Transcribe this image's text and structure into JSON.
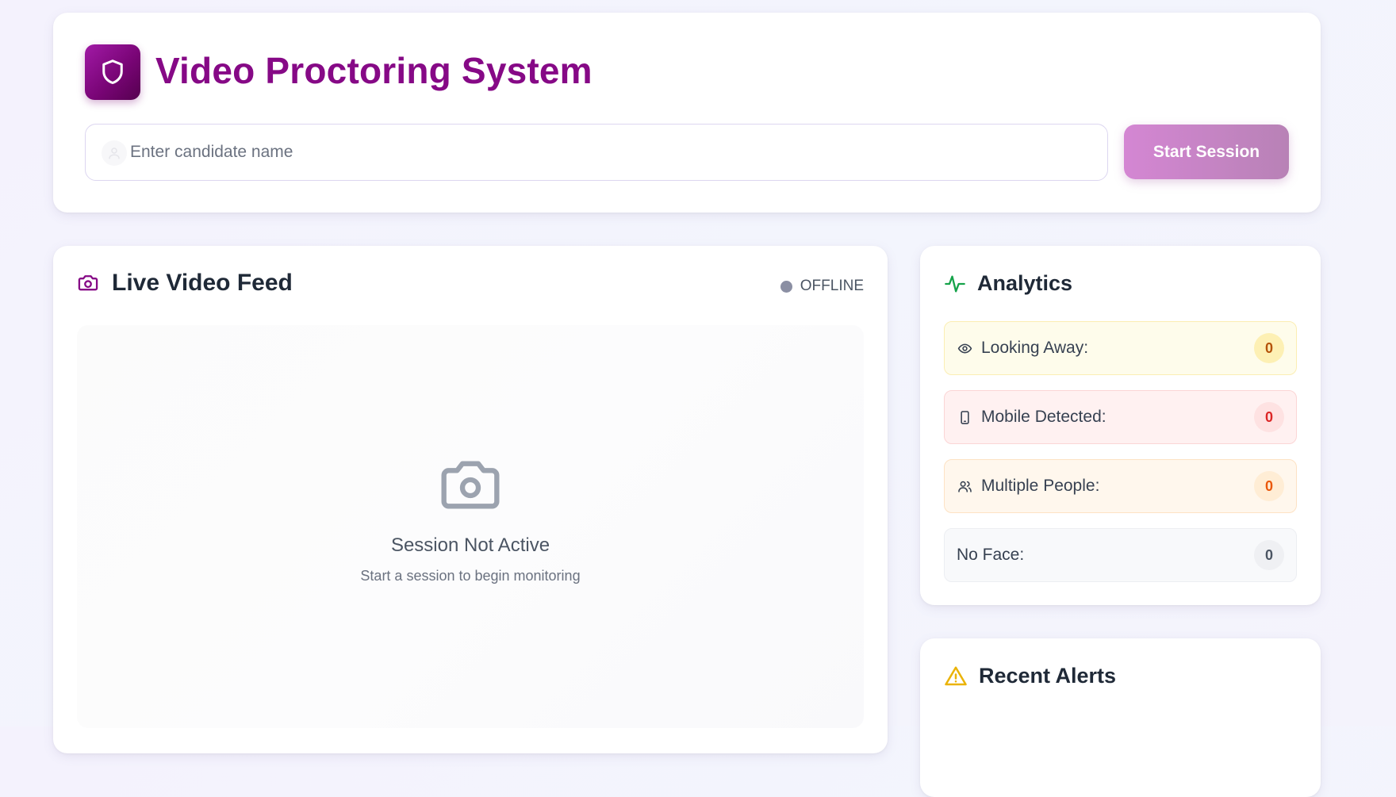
{
  "header": {
    "title": "Video Proctoring System",
    "logo_icon": "shield-icon",
    "candidate_input": {
      "placeholder": "Enter candidate name",
      "value": ""
    },
    "start_button_label": "Start Session"
  },
  "video": {
    "title": "Live Video Feed",
    "status_label": "OFFLINE",
    "empty_primary": "Session Not Active",
    "empty_secondary": "Start a session to begin monitoring"
  },
  "analytics": {
    "title": "Analytics",
    "metrics": [
      {
        "icon": "eye-icon",
        "label": "Looking Away:",
        "count": "0"
      },
      {
        "icon": "mobile-icon",
        "label": "Mobile Detected:",
        "count": "0"
      },
      {
        "icon": "users-icon",
        "label": "Multiple People:",
        "count": "0"
      },
      {
        "icon": "",
        "label": "No Face:",
        "count": "0"
      }
    ]
  },
  "alerts": {
    "title": "Recent Alerts"
  },
  "colors": {
    "brand": "#860986",
    "start_button_gradient": [
      "#d486d3",
      "#b882b6"
    ],
    "status_offline": "#8b8fa3",
    "analytics_icon": "#16a34a",
    "alert_icon": "#eab308"
  }
}
